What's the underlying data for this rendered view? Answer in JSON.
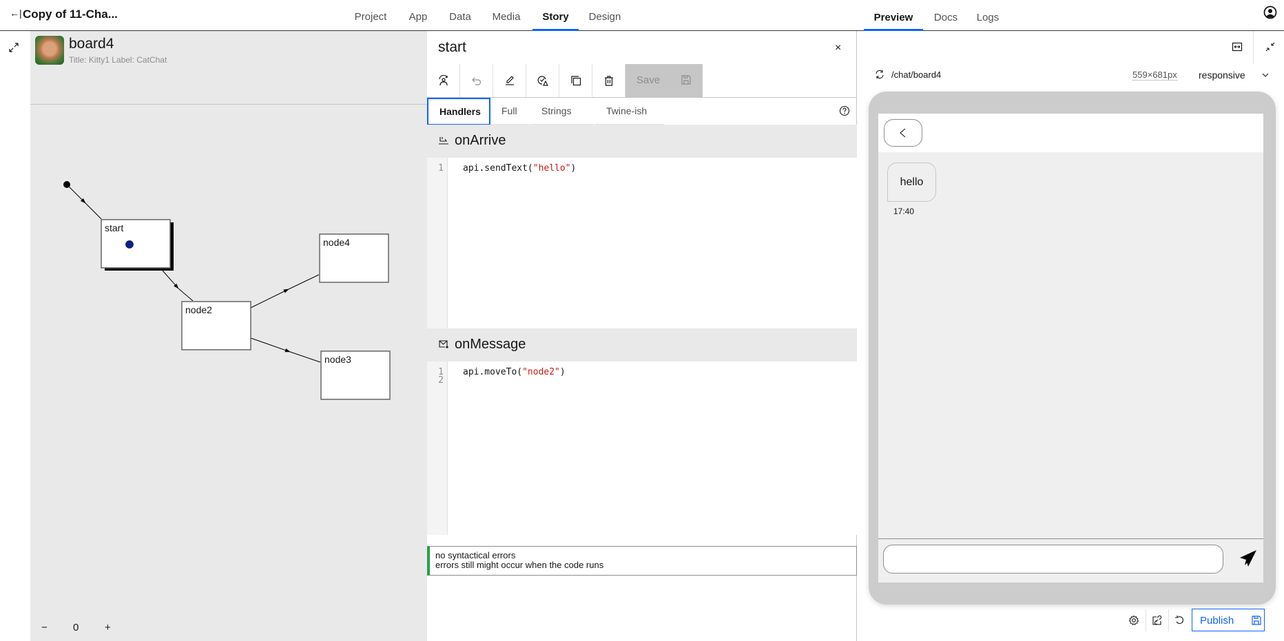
{
  "topbar": {
    "back_icon": "exit-arrow-icon",
    "project_title": "Copy of 11-Cha...",
    "nav_tabs": [
      {
        "label": "Project",
        "active": false
      },
      {
        "label": "App",
        "active": false
      },
      {
        "label": "Data",
        "active": false
      },
      {
        "label": "Media",
        "active": false
      },
      {
        "label": "Story",
        "active": true
      },
      {
        "label": "Design",
        "active": false
      }
    ],
    "user_icon": "user-avatar-icon",
    "accent_color": "#0f62fe"
  },
  "board": {
    "name": "board4",
    "subtitle": "Title: Kitty1 Label: CatChat",
    "avatar": "cat-photo",
    "zoom": {
      "minus": "−",
      "value": "0",
      "plus": "+"
    }
  },
  "graph": {
    "nodes": [
      {
        "id": "start",
        "label": "start",
        "selected": true,
        "has_marker": true
      },
      {
        "id": "node2",
        "label": "node2",
        "selected": false
      },
      {
        "id": "node4",
        "label": "node4",
        "selected": false
      },
      {
        "id": "node3",
        "label": "node3",
        "selected": false
      }
    ],
    "edges": [
      {
        "from": "entry",
        "to": "start"
      },
      {
        "from": "start",
        "to": "node2"
      },
      {
        "from": "node2",
        "to": "node4"
      },
      {
        "from": "node2",
        "to": "node3"
      }
    ]
  },
  "editor": {
    "node_title": "start",
    "close_label": "×",
    "toolbar": {
      "icons": [
        "set-start-icon",
        "undo-icon",
        "edit-icon",
        "check-syntax-icon",
        "duplicate-icon",
        "delete-icon"
      ],
      "save_label": "Save",
      "save_icon": "save-icon"
    },
    "tabs": [
      {
        "label": "Handlers",
        "active": true
      },
      {
        "label": "Full",
        "active": false
      },
      {
        "label": "Strings",
        "active": false
      },
      {
        "label": "Twine-ish",
        "active": false
      }
    ],
    "handlers": [
      {
        "name": "onArrive",
        "icon": "arrive-icon",
        "lines": [
          {
            "num": "1",
            "prefix": "api.sendText(",
            "string": "\"hello\"",
            "suffix": ")"
          }
        ]
      },
      {
        "name": "onMessage",
        "icon": "message-icon",
        "lines": [
          {
            "num": "1",
            "prefix": "api.moveTo(",
            "string": "\"node2\"",
            "suffix": ")"
          },
          {
            "num": "2",
            "prefix": "",
            "string": "",
            "suffix": ""
          }
        ]
      }
    ],
    "status": {
      "line1": "no syntactical errors",
      "line2": "errors still might occur when the code runs",
      "color": "#24a148"
    }
  },
  "preview": {
    "tabs": [
      {
        "label": "Preview",
        "active": true
      },
      {
        "label": "Docs",
        "active": false
      },
      {
        "label": "Logs",
        "active": false
      }
    ],
    "route": "/chat/board4",
    "dimensions": "559×681px",
    "mode": "responsive",
    "chat": {
      "messages": [
        {
          "text": "hello",
          "time": "17:40"
        }
      ],
      "input_value": "",
      "input_placeholder": ""
    },
    "publish_label": "Publish"
  }
}
